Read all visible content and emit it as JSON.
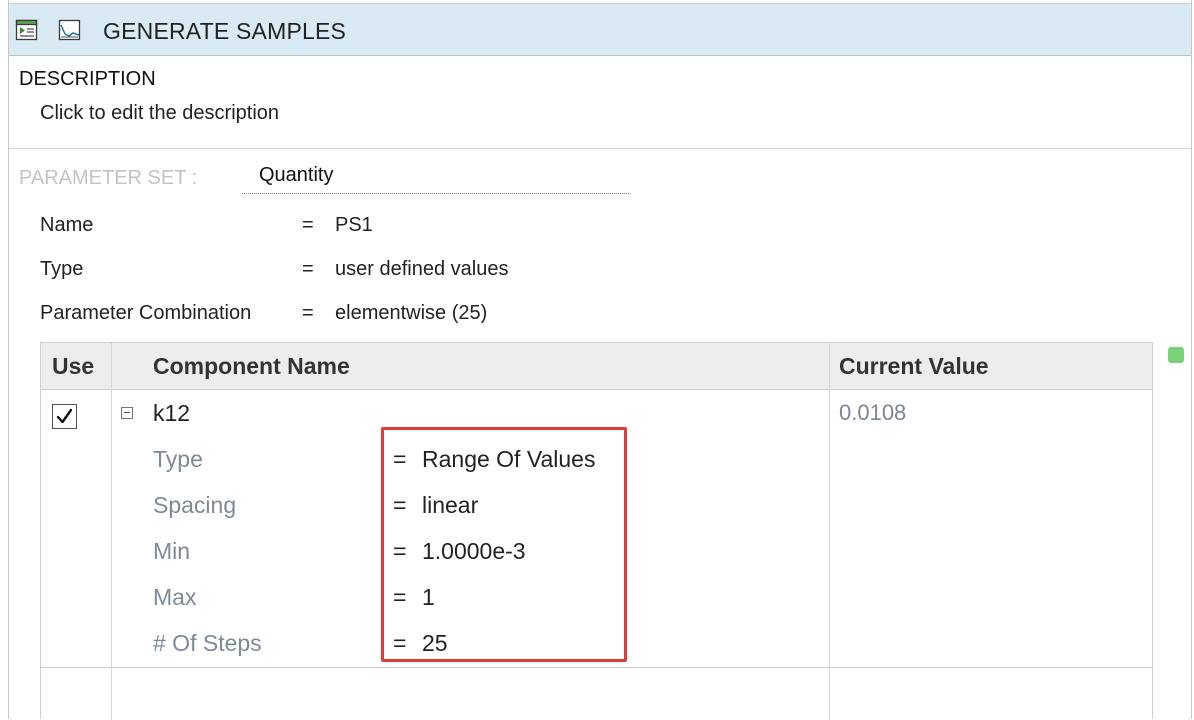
{
  "title_bar": {
    "title": "GENERATE SAMPLES",
    "icons": [
      "run-icon",
      "plot-icon"
    ]
  },
  "description": {
    "heading": "DESCRIPTION",
    "text": "Click to edit the description"
  },
  "parameter_set": {
    "label": "PARAMETER SET :",
    "value": "Quantity",
    "properties": [
      {
        "label": "Name",
        "eq": "=",
        "value": "PS1"
      },
      {
        "label": "Type",
        "eq": "=",
        "value": "user defined values"
      },
      {
        "label": "Parameter Combination",
        "eq": "=",
        "value": "elementwise (25)"
      }
    ]
  },
  "table": {
    "headers": {
      "use": "Use",
      "component_name": "Component Name",
      "current_value": "Current Value"
    },
    "rows": [
      {
        "checked": true,
        "checkmark": "✓",
        "name": "k12",
        "current_value": "0.0108",
        "expanded": true,
        "details": [
          {
            "label": "Type",
            "eq": "=",
            "value": "Range Of Values"
          },
          {
            "label": "Spacing",
            "eq": "=",
            "value": "linear"
          },
          {
            "label": "Min",
            "eq": "=",
            "value": "1.0000e-3"
          },
          {
            "label": "Max",
            "eq": "=",
            "value": "1"
          },
          {
            "label": "# Of Steps",
            "eq": "=",
            "value": "25"
          }
        ]
      }
    ]
  },
  "colors": {
    "title_bar_bg": "#d9eaf5",
    "header_bg": "#ededed",
    "highlight_border": "#e23b3b",
    "status_indicator": "#7ad27a",
    "muted_text": "#7f8a99"
  }
}
